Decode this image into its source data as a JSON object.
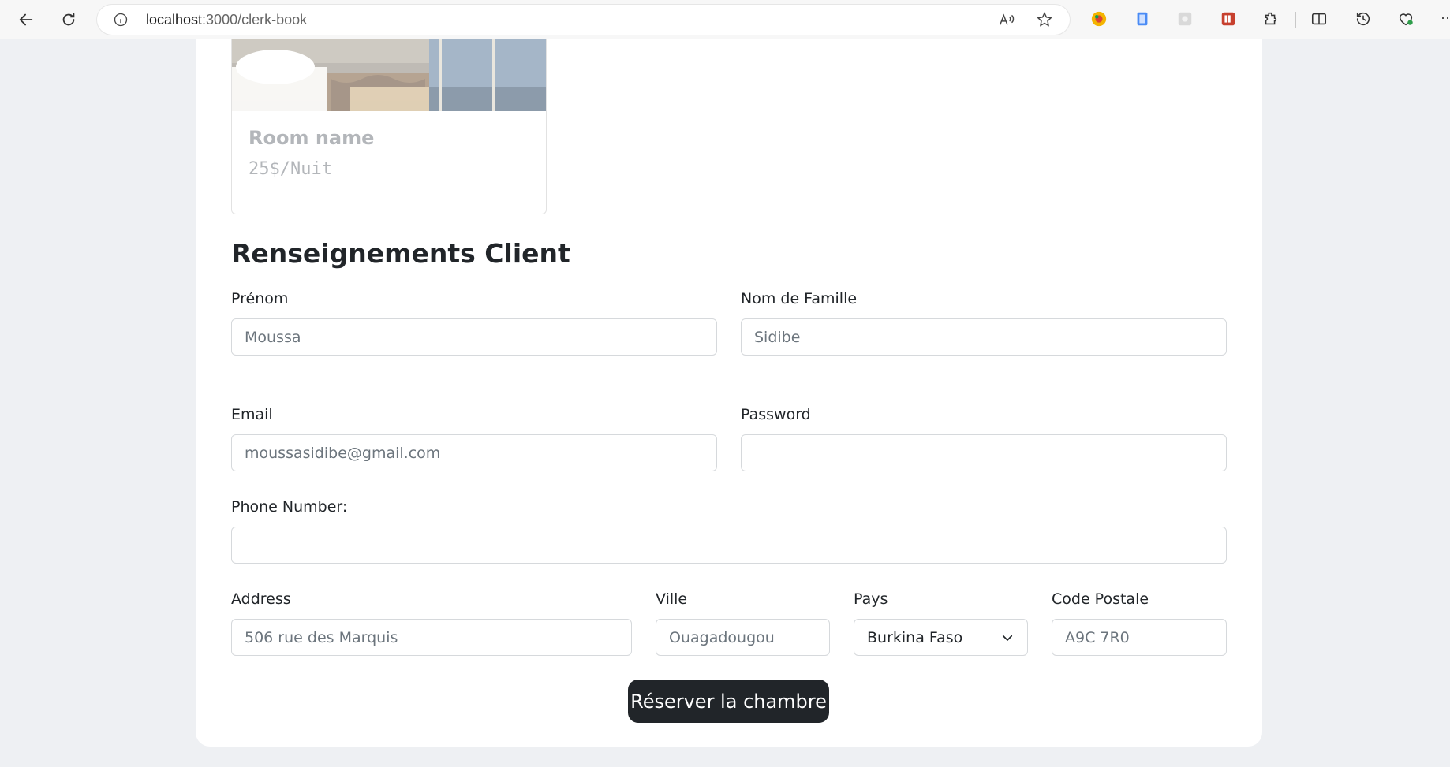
{
  "browser": {
    "url_host": "localhost",
    "url_path": ":3000/clerk-book",
    "more_label": "···"
  },
  "room": {
    "name": "Room name",
    "price": "25$/Nuit"
  },
  "form": {
    "title": "Renseignements Client",
    "first_name": {
      "label": "Prénom",
      "placeholder": "Moussa"
    },
    "last_name": {
      "label": "Nom de Famille",
      "placeholder": "Sidibe"
    },
    "email": {
      "label": "Email",
      "placeholder": "moussasidibe@gmail.com"
    },
    "password": {
      "label": "Password",
      "placeholder": ""
    },
    "phone": {
      "label": "Phone Number:",
      "placeholder": ""
    },
    "address": {
      "label": "Address",
      "placeholder": "506 rue des Marquis"
    },
    "city": {
      "label": "Ville",
      "placeholder": "Ouagadougou"
    },
    "country": {
      "label": "Pays",
      "value": "Burkina Faso"
    },
    "postal": {
      "label": "Code Postale",
      "placeholder": "A9C 7R0"
    },
    "submit_label": "Réserver la chambre"
  },
  "colors": {
    "page_bg": "#eef0f3",
    "button_bg": "#212529",
    "muted_text": "#b3b6ba"
  }
}
